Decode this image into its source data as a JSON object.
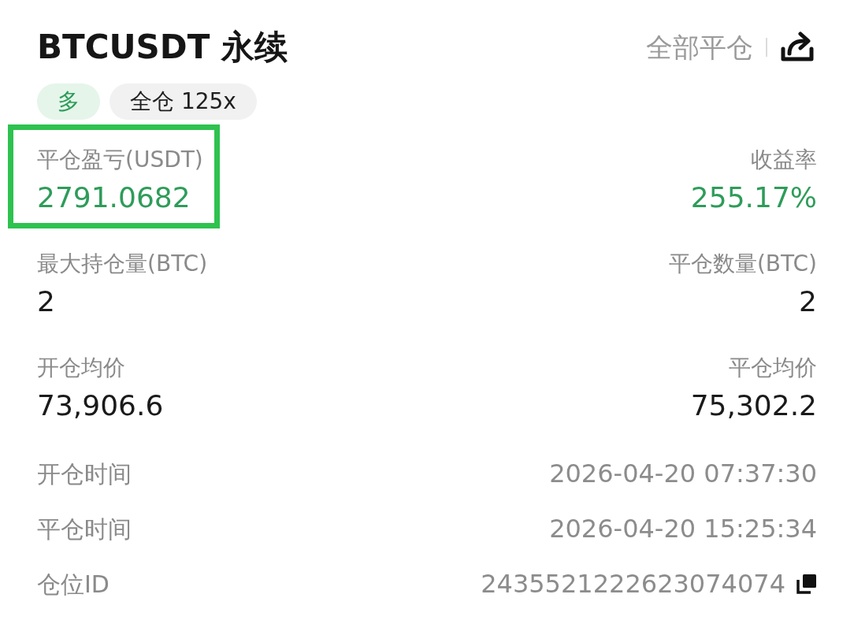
{
  "header": {
    "title": "BTCUSDT 永续",
    "close_all": "全部平仓"
  },
  "tags": [
    {
      "label": "多",
      "kind": "side"
    },
    {
      "label": "全仓 125x",
      "kind": "margin"
    }
  ],
  "stats": [
    {
      "label": "平仓盈亏(USDT)",
      "value": "2791.0682",
      "color": "#2e9c5a",
      "highlighted": true
    },
    {
      "label": "收益率",
      "value": "255.17%",
      "color": "#2e9c5a",
      "highlighted": false
    },
    {
      "label": "最大持仓量(BTC)",
      "value": "2",
      "color": "#1a1a1a",
      "highlighted": false
    },
    {
      "label": "平仓数量(BTC)",
      "value": "2",
      "color": "#1a1a1a",
      "highlighted": false
    },
    {
      "label": "开仓均价",
      "value": "73,906.6",
      "color": "#1a1a1a",
      "highlighted": false
    },
    {
      "label": "平仓均价",
      "value": "75,302.2",
      "color": "#1a1a1a",
      "highlighted": false
    }
  ],
  "details": [
    {
      "label": "开仓时间",
      "value": "2026-04-20 07:37:30",
      "kind": "text"
    },
    {
      "label": "平仓时间",
      "value": "2026-04-20 15:25:34",
      "kind": "text"
    },
    {
      "label": "仓位ID",
      "value": "2435521222623074074",
      "kind": "copyable"
    }
  ]
}
